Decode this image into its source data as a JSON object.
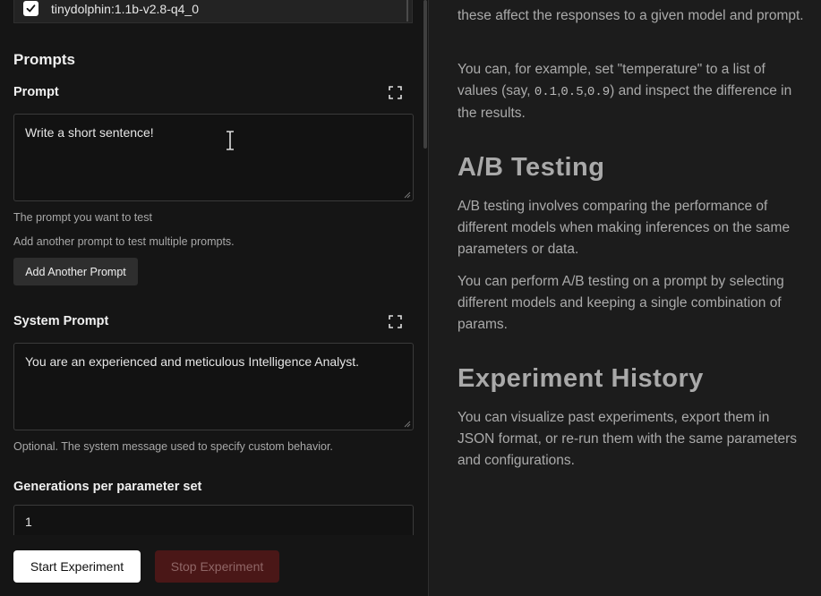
{
  "models": {
    "visible_item": {
      "label": "tinydolphin:1.1b-v2.8-q4_0",
      "checked": true
    }
  },
  "prompts_section": {
    "title": "Prompts",
    "prompt": {
      "label": "Prompt",
      "value": "Write a short sentence!",
      "help": "The prompt you want to test",
      "add_hint": "Add another prompt to test multiple prompts.",
      "add_button": "Add Another Prompt"
    },
    "system_prompt": {
      "label": "System Prompt",
      "value": "You are an experienced and meticulous Intelligence Analyst.",
      "help": "Optional. The system message used to specify custom behavior."
    },
    "generations": {
      "label": "Generations per parameter set",
      "value": "1"
    }
  },
  "actions": {
    "start": "Start Experiment",
    "stop": "Stop Experiment"
  },
  "docs": {
    "intro_p1": "these affect the responses to a given model and prompt.",
    "intro_p2_a": "You can, for example, set \"temperature\" to a list of values (say, ",
    "intro_p2_codes": [
      "0.1",
      "0.5",
      "0.9"
    ],
    "intro_p2_b": ") and inspect the difference in the results.",
    "ab_heading": "A/B Testing",
    "ab_p1": "A/B testing involves comparing the performance of different models when making inferences on the same parameters or data.",
    "ab_p2": "You can perform A/B testing on a prompt by selecting different models and keeping a single combination of params.",
    "history_heading": "Experiment History",
    "history_p1": "You can visualize past experiments, export them in JSON format, or re-run them with the same parameters and configurations."
  },
  "colors": {
    "background": "#151515",
    "panel_right": "#1c1c1c",
    "primary_button": "#ffffff",
    "stop_button": "#4a1717"
  }
}
